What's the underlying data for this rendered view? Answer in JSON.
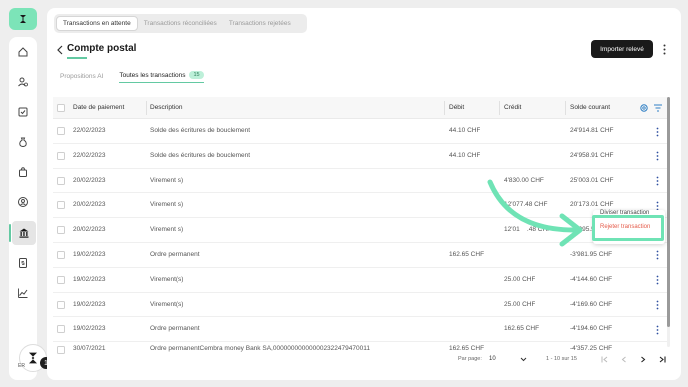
{
  "sidebar": {
    "logo_icon": "brand-logo-icon",
    "items": [
      {
        "icon": "home-icon"
      },
      {
        "icon": "user-coin-icon"
      },
      {
        "icon": "checkbox-icon"
      },
      {
        "icon": "money-bag-icon"
      },
      {
        "icon": "shopping-bag-icon"
      },
      {
        "icon": "user-circle-icon"
      },
      {
        "icon": "bank-icon",
        "active": true
      },
      {
        "icon": "document-dollar-icon"
      },
      {
        "icon": "chart-line-icon"
      }
    ],
    "user": {
      "initials": "ER",
      "notifications": "1"
    },
    "accent": "#63c9a2"
  },
  "top_tabs": [
    {
      "label": "Transactions en attente",
      "active": true
    },
    {
      "label": "Transactions réconciliées"
    },
    {
      "label": "Transactions rejetées"
    }
  ],
  "header": {
    "title": "Compte postal",
    "import_label": "Importer relevé"
  },
  "sub_tabs": [
    {
      "label": "Propositions AI"
    },
    {
      "label": "Toutes les transactions",
      "count": "15",
      "active": true
    }
  ],
  "table": {
    "columns": [
      "Date de paiement",
      "Description",
      "Débit",
      "Crédit",
      "Solde courant"
    ],
    "rows": [
      {
        "date": "22/02/2023",
        "description": "Solde des écritures de bouclement",
        "debit": "44.10 CHF",
        "credit": "",
        "balance": "24'914.81 CHF"
      },
      {
        "date": "22/02/2023",
        "description": "Solde des écritures de bouclement",
        "debit": "44.10 CHF",
        "credit": "",
        "balance": "24'958.91 CHF"
      },
      {
        "date": "20/02/2023",
        "description": "Virement s)",
        "debit": "",
        "credit": "4'830.00 CHF",
        "balance": "25'003.01 CHF"
      },
      {
        "date": "20/02/2023",
        "description": "Virement s)",
        "debit": "",
        "credit": "12'077.48 CHF",
        "balance": "20'173.01 CHF"
      },
      {
        "date": "20/02/2023",
        "description": "Virement s)",
        "debit": "",
        "credit": "12'01    .48 CHF",
        "balance": "    '095.5"
      },
      {
        "date": "19/02/2023",
        "description": "Ordre permanent",
        "debit": "162.65 CHF",
        "credit": "",
        "balance": "-3'981.95 CHF"
      },
      {
        "date": "19/02/2023",
        "description": "Virement(s)",
        "debit": "",
        "credit": "25.00 CHF",
        "balance": "-4'144.60 CHF"
      },
      {
        "date": "19/02/2023",
        "description": "Virement(s)",
        "debit": "",
        "credit": "25.00 CHF",
        "balance": "-4'169.60 CHF"
      },
      {
        "date": "19/02/2023",
        "description": "Ordre permanent",
        "debit": "",
        "credit": "162.65 CHF",
        "balance": "-4'194.60 CHF"
      },
      {
        "date": "30/07/2021",
        "description": "Ordre permanentCembra money Bank SA,000000000000002322479470011",
        "debit": "162.65 CHF",
        "credit": "",
        "balance": "-4'357.25 CHF"
      }
    ]
  },
  "row_menu": {
    "divide_label": "Diviser transaction",
    "reject_label": "Rejeter transaction",
    "reject_color": "#e55b4a",
    "highlight_color": "#6fe3b5"
  },
  "pagination": {
    "per_page_label": "Par page:",
    "per_page_value": "10",
    "range_label": "1 - 10 sur 15"
  }
}
